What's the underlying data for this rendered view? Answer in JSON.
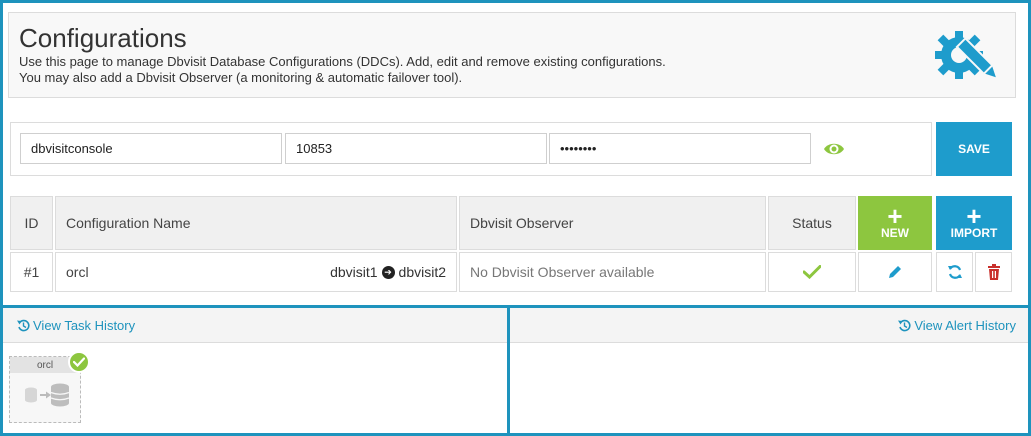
{
  "header": {
    "title": "Configurations",
    "description_line1": "Use this page to manage Dbvisit Database Configurations (DDCs). Add, edit and remove existing configurations.",
    "description_line2": "You may also add a Dbvisit Observer (a monitoring & automatic failover tool).",
    "icon": "gear-pencil-icon"
  },
  "credentials": {
    "username": "dbvisitconsole",
    "port": "10853",
    "password": "••••••••",
    "save_label": "SAVE"
  },
  "table": {
    "headers": {
      "id": "ID",
      "name": "Configuration Name",
      "observer": "Dbvisit Observer",
      "status": "Status"
    },
    "new_label": "NEW",
    "import_label": "IMPORT",
    "rows": [
      {
        "id": "#1",
        "name": "orcl",
        "primary": "dbvisit1",
        "standby": "dbvisit2",
        "observer": "No Dbvisit Observer available",
        "status": "ok"
      }
    ]
  },
  "task_history": {
    "link_label": "View Task History",
    "card_label": "orcl"
  },
  "alert_history": {
    "link_label": "View Alert History"
  },
  "colors": {
    "accent": "#1e9ccc",
    "success": "#8dc63f",
    "danger": "#c9302c"
  }
}
